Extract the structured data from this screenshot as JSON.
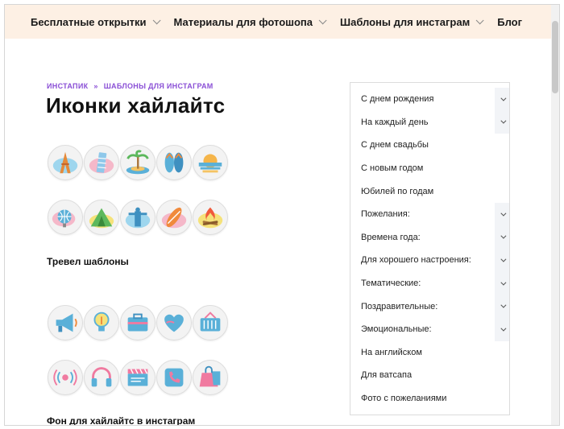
{
  "nav": {
    "items": [
      {
        "label": "Бесплатные открытки",
        "dropdown": true
      },
      {
        "label": "Материалы для фотошопа",
        "dropdown": true
      },
      {
        "label": "Шаблоны для инстаграм",
        "dropdown": true
      },
      {
        "label": "Блог",
        "dropdown": false
      }
    ]
  },
  "breadcrumb": {
    "home": "ИНСТАПИК",
    "separator": "»",
    "current": "ШАБЛОНЫ ДЛЯ ИНСТАГРАМ"
  },
  "page": {
    "title": "Иконки хайлайтс"
  },
  "sections": [
    {
      "caption": "Тревел шаблоны",
      "icons": [
        "eiffel-tower-icon",
        "leaning-tower-icon",
        "palm-island-icon",
        "flip-flops-icon",
        "sunset-sea-icon",
        "globe-icon",
        "tent-icon",
        "statue-icon",
        "surfboard-icon",
        "campfire-icon"
      ]
    },
    {
      "caption": "Фон для хайлайтс в инстаграм",
      "icons": [
        "megaphone-icon",
        "lightbulb-icon",
        "briefcase-icon",
        "heart-icon",
        "basket-icon",
        "broadcast-icon",
        "headphones-icon",
        "clapperboard-icon",
        "phone-icon",
        "shopping-bag-icon"
      ]
    }
  ],
  "sidebar": {
    "items": [
      {
        "label": "С днем рождения",
        "expandable": true
      },
      {
        "label": "На каждый день",
        "expandable": true
      },
      {
        "label": "С днем свадьбы",
        "expandable": false
      },
      {
        "label": "С новым годом",
        "expandable": false
      },
      {
        "label": "Юбилей по годам",
        "expandable": false
      },
      {
        "label": "Пожелания:",
        "expandable": true
      },
      {
        "label": "Времена года:",
        "expandable": true
      },
      {
        "label": "Для хорошего настроения:",
        "expandable": true
      },
      {
        "label": "Тематические:",
        "expandable": true
      },
      {
        "label": "Поздравительные:",
        "expandable": true
      },
      {
        "label": "Эмоциональные:",
        "expandable": true
      },
      {
        "label": "На английском",
        "expandable": false
      },
      {
        "label": "Для ватсапа",
        "expandable": false
      },
      {
        "label": "Фото с пожеланиями",
        "expandable": false
      }
    ]
  },
  "colors": {
    "nav_bg": "#fdf0e4",
    "breadcrumb": "#8a4fd6",
    "icon_blue": "#5ab0d8",
    "icon_orange": "#f08a3c",
    "icon_pink": "#f07aa0",
    "icon_green": "#7cc36a"
  }
}
